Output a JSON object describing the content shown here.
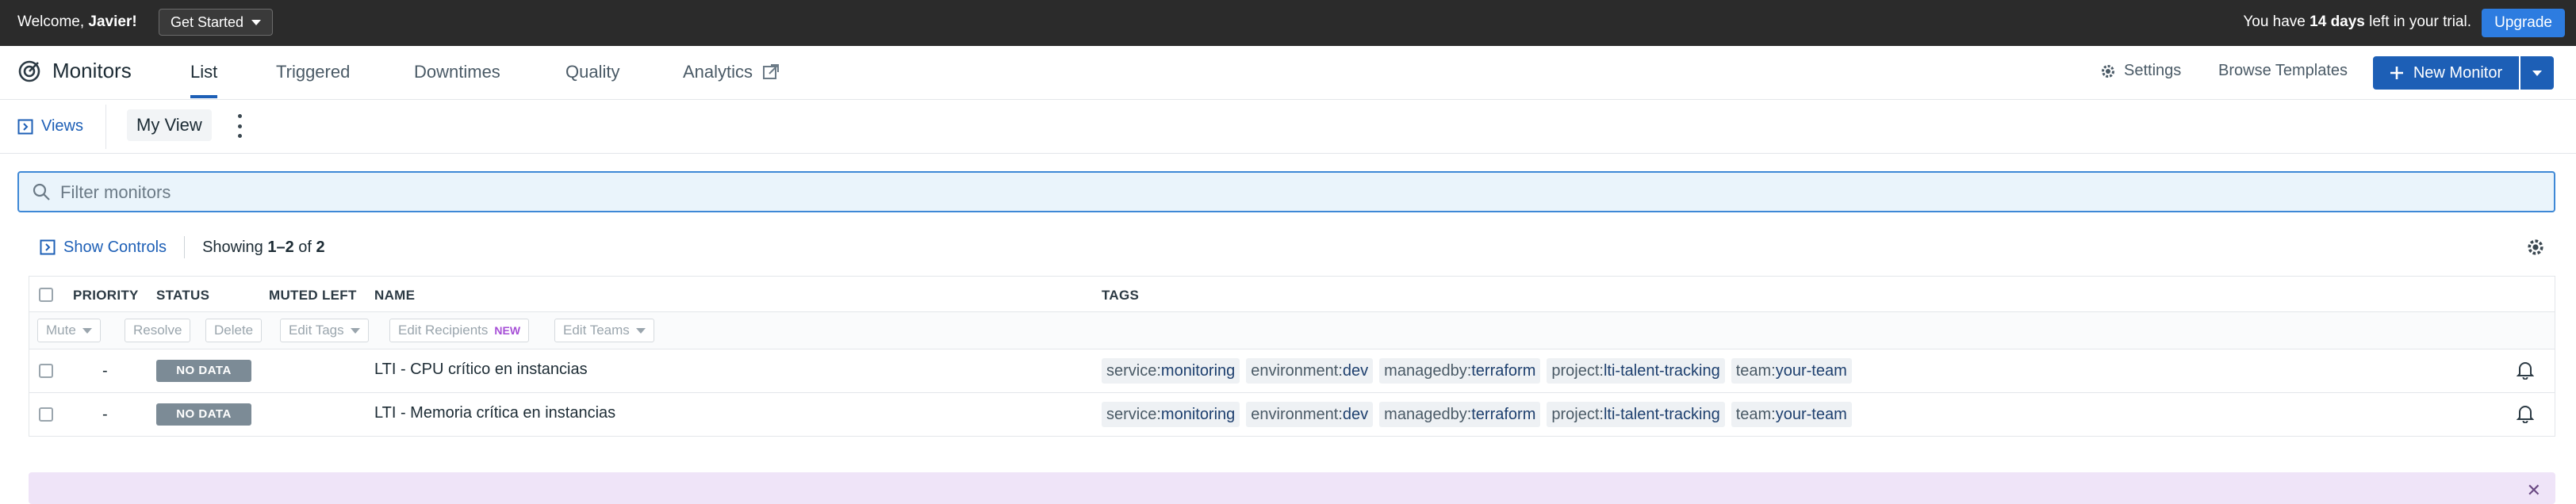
{
  "topbar": {
    "welcome_prefix": "Welcome, ",
    "welcome_name": "Javier!",
    "get_started": "Get Started",
    "trial_prefix": "You have ",
    "trial_days": "14 days",
    "trial_suffix": " left in your trial.",
    "upgrade": "Upgrade"
  },
  "nav": {
    "app_title": "Monitors",
    "tabs": [
      {
        "label": "List",
        "active": true
      },
      {
        "label": "Triggered"
      },
      {
        "label": "Downtimes"
      },
      {
        "label": "Quality"
      },
      {
        "label": "Analytics"
      }
    ],
    "settings": "Settings",
    "browse_templates": "Browse Templates",
    "new_monitor": "New Monitor"
  },
  "views": {
    "views_label": "Views",
    "current_view": "My View"
  },
  "filter": {
    "placeholder": "Filter monitors",
    "value": ""
  },
  "controls": {
    "show_controls": "Show Controls",
    "showing_prefix": "Showing ",
    "showing_range": "1–2",
    "showing_of": " of ",
    "showing_total": "2"
  },
  "table": {
    "columns": {
      "priority": "PRIORITY",
      "status": "STATUS",
      "muted_left": "MUTED LEFT",
      "name": "NAME",
      "tags": "TAGS"
    },
    "toolbar": {
      "mute": "Mute",
      "resolve": "Resolve",
      "delete": "Delete",
      "edit_tags": "Edit Tags",
      "edit_recipients": "Edit Recipients",
      "new_badge": "NEW",
      "edit_teams": "Edit Teams"
    },
    "rows": [
      {
        "priority": "-",
        "status": "NO DATA",
        "name": "LTI - CPU crítico en instancias",
        "tags": [
          {
            "key": "service:",
            "value": "monitoring"
          },
          {
            "key": "environment:",
            "value": "dev"
          },
          {
            "key": "managedby:",
            "value": "terraform"
          },
          {
            "key": "project:",
            "value": "lti-talent-tracking"
          },
          {
            "key": "team:",
            "value": "your-team"
          }
        ]
      },
      {
        "priority": "-",
        "status": "NO DATA",
        "name": "LTI - Memoria crítica en instancias",
        "tags": [
          {
            "key": "service:",
            "value": "monitoring"
          },
          {
            "key": "environment:",
            "value": "dev"
          },
          {
            "key": "managedby:",
            "value": "terraform"
          },
          {
            "key": "project:",
            "value": "lti-talent-tracking"
          },
          {
            "key": "team:",
            "value": "your-team"
          }
        ]
      }
    ]
  },
  "colors": {
    "accent": "#1d5fb6",
    "topbar_bg": "#2b2b2b",
    "upgrade_bg": "#2d7ce0",
    "status_nodata": "#7c8b96",
    "banner_bg": "#efe4f8"
  }
}
